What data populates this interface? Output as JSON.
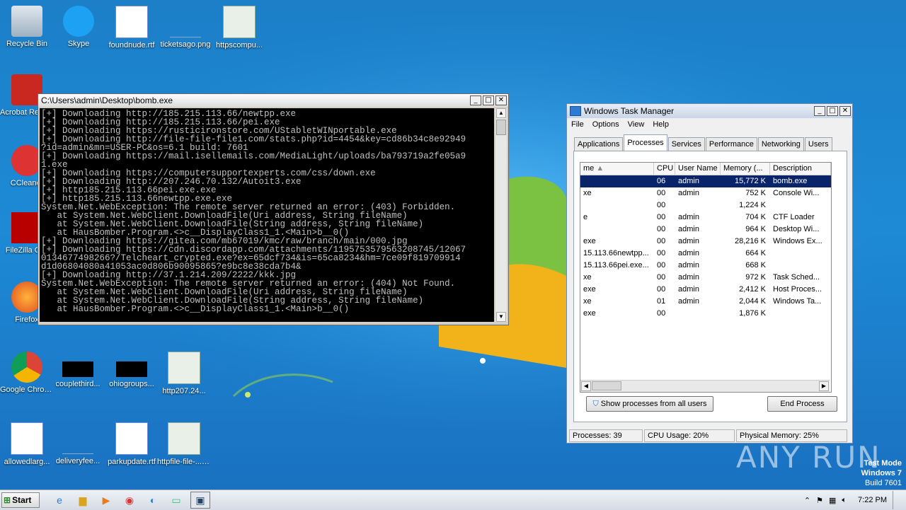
{
  "desktop": {
    "icons": [
      {
        "label": "Recycle Bin",
        "icon": "recycle-bin-icon"
      },
      {
        "label": "Skype",
        "icon": "skype-icon"
      },
      {
        "label": "foundnude.rtf",
        "icon": "word-document-icon"
      },
      {
        "label": "ticketsago.png",
        "icon": "image-file-icon"
      },
      {
        "label": "httpscompu...",
        "icon": "window-file-icon"
      },
      {
        "label": "Acrobat Reader DC",
        "icon": "acrobat-icon"
      },
      {
        "label": "CCleaner",
        "icon": "ccleaner-icon"
      },
      {
        "label": "FileZilla Cl...",
        "icon": "filezilla-icon"
      },
      {
        "label": "Firefox",
        "icon": "firefox-icon"
      },
      {
        "label": "Google Chrome",
        "icon": "chrome-icon"
      },
      {
        "label": "couplethird...",
        "icon": "black-file-icon"
      },
      {
        "label": "ohiogroups...",
        "icon": "black-file-icon"
      },
      {
        "label": "http207.24...",
        "icon": "window-file-icon"
      },
      {
        "label": "allowedlarg...",
        "icon": "word-document-icon"
      },
      {
        "label": "deliveryfee...",
        "icon": "blank-file-icon"
      },
      {
        "label": "parkupdate.rtf",
        "icon": "word-document-icon"
      },
      {
        "label": "httpfile-file-... build 7601.exe",
        "icon": "window-file-icon"
      }
    ]
  },
  "console": {
    "title": "C:\\Users\\admin\\Desktop\\bomb.exe",
    "lines": [
      "[+] Downloading http://185.215.113.66/newtpp.exe",
      "[+] Downloading http://185.215.113.66/pei.exe",
      "[+] Downloading https://rusticironstore.com/UStabletWINportable.exe",
      "[+] Downloading http://file-file-file1.com/stats.php?id=4454&key=cd86b34c8e92949",
      "?id=admin&mn=USER-PC&os=6.1 build: 7601",
      "[+] Downloading https://mail.isellemails.com/MediaLight/uploads/ba793719a2fe05a9",
      "1.exe",
      "[+] Downloading https://computersupportexperts.com/css/down.exe",
      "[+] Downloading http://207.246.70.132/Autoit3.exe",
      "[+] http185.215.113.66pei.exe.exe",
      "[+] http185.215.113.66newtpp.exe.exe",
      "System.Net.WebException: The remote server returned an error: (403) Forbidden.",
      "   at System.Net.WebClient.DownloadFile(Uri address, String fileName)",
      "   at System.Net.WebClient.DownloadFile(String address, String fileName)",
      "   at HausBomber.Program.<>c__DisplayClass1_1.<Main>b__0()",
      "[+] Downloading https://gitea.com/mb67019/kmc/raw/branch/main/000.jpg",
      "[+] Downloading https://cdn.discordapp.com/attachments/1195753579563208745/12067",
      "0134677498266?/Telcheart_crypted.exe?ex=65dcf734&is=65ca8234&hm=7ce09f819709914",
      "d1d06804080a41053ac0d806b90095865?e9bc8e38cda7b4&",
      "[+] Downloading http://37.1.214.209/2222/kkk.jpg",
      "System.Net.WebException: The remote server returned an error: (404) Not Found.",
      "   at System.Net.WebClient.DownloadFile(Uri address, String fileName)",
      "   at System.Net.WebClient.DownloadFile(String address, String fileName)",
      "   at HausBomber.Program.<>c__DisplayClass1_1.<Main>b__0()"
    ]
  },
  "taskmanager": {
    "title": "Windows Task Manager",
    "menu": [
      "File",
      "Options",
      "View",
      "Help"
    ],
    "tabs": [
      "Applications",
      "Processes",
      "Services",
      "Performance",
      "Networking",
      "Users"
    ],
    "active_tab": "Processes",
    "columns": [
      "me",
      "CPU",
      "User Name",
      "Memory (...",
      "Description"
    ],
    "rows": [
      {
        "name": "",
        "cpu": "06",
        "user": "admin",
        "mem": "15,772 K",
        "desc": "bomb.exe",
        "selected": true
      },
      {
        "name": "xe",
        "cpu": "00",
        "user": "admin",
        "mem": "752 K",
        "desc": "Console Wi..."
      },
      {
        "name": "",
        "cpu": "00",
        "user": "",
        "mem": "1,224 K",
        "desc": ""
      },
      {
        "name": "e",
        "cpu": "00",
        "user": "admin",
        "mem": "704 K",
        "desc": "CTF Loader"
      },
      {
        "name": "",
        "cpu": "00",
        "user": "admin",
        "mem": "964 K",
        "desc": "Desktop Wi..."
      },
      {
        "name": "exe",
        "cpu": "00",
        "user": "admin",
        "mem": "28,216 K",
        "desc": "Windows Ex..."
      },
      {
        "name": "15.113.66newtpp...",
        "cpu": "00",
        "user": "admin",
        "mem": "664 K",
        "desc": ""
      },
      {
        "name": "15.113.66pei.exe...",
        "cpu": "00",
        "user": "admin",
        "mem": "668 K",
        "desc": ""
      },
      {
        "name": "xe",
        "cpu": "00",
        "user": "admin",
        "mem": "972 K",
        "desc": "Task Sched..."
      },
      {
        "name": "exe",
        "cpu": "00",
        "user": "admin",
        "mem": "2,412 K",
        "desc": "Host Proces..."
      },
      {
        "name": "xe",
        "cpu": "01",
        "user": "admin",
        "mem": "2,044 K",
        "desc": "Windows Ta..."
      },
      {
        "name": "exe",
        "cpu": "00",
        "user": "",
        "mem": "1,876 K",
        "desc": ""
      }
    ],
    "show_all_label": "Show processes from all users",
    "end_process_label": "End Process",
    "status": {
      "processes": "Processes: 39",
      "cpu": "CPU Usage: 20%",
      "memory": "Physical Memory: 25%"
    }
  },
  "watermark": "ANY RUN",
  "osinfo": {
    "line1": "Test Mode",
    "line2": "Windows 7",
    "line3": "Build 7601"
  },
  "taskbar": {
    "start_label": "Start",
    "items": [
      "ie-icon",
      "explorer-icon",
      "media-player-icon",
      "chrome-icon",
      "edge-icon",
      "window-icon",
      "task-manager-icon"
    ],
    "clock": "7:22 PM"
  }
}
